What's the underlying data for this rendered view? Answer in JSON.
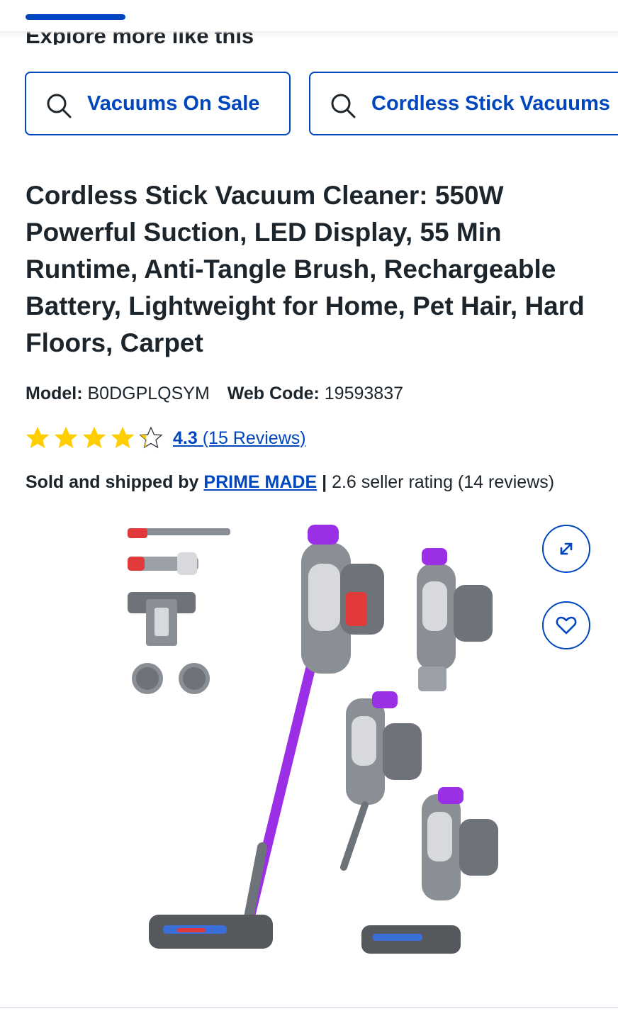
{
  "header": {
    "section_title": "Explore more like this"
  },
  "chips": [
    {
      "label": "Vacuums On Sale",
      "icon": "search-icon"
    },
    {
      "label": "Cordless Stick Vacuums",
      "icon": "search-icon"
    }
  ],
  "product": {
    "title": "Cordless Stick Vacuum Cleaner: 550W Powerful Suction, LED Display, 55 Min Runtime, Anti-Tangle Brush, Rechargeable Battery, Lightweight for Home, Pet Hair, Hard Floors, Carpet",
    "model_label": "Model:",
    "model_value": "B0DGPLQSYM",
    "webcode_label": "Web Code:",
    "webcode_value": "19593837",
    "rating_value": "4.3",
    "rating_stars": 4.3,
    "rating_max": 5,
    "reviews_text": "(15 Reviews)",
    "seller_prefix": "Sold and shipped by",
    "seller_name": "PRIME MADE",
    "seller_separator": "|",
    "seller_rating_text": "2.6 seller rating (14 reviews)"
  },
  "actions": {
    "expand_icon": "expand-icon",
    "favorite_icon": "heart-icon"
  },
  "colors": {
    "accent": "#0046be",
    "text": "#1d252c",
    "star": "#ffce00",
    "product_purple": "#9b2fe6",
    "product_red": "#e23a3a"
  }
}
